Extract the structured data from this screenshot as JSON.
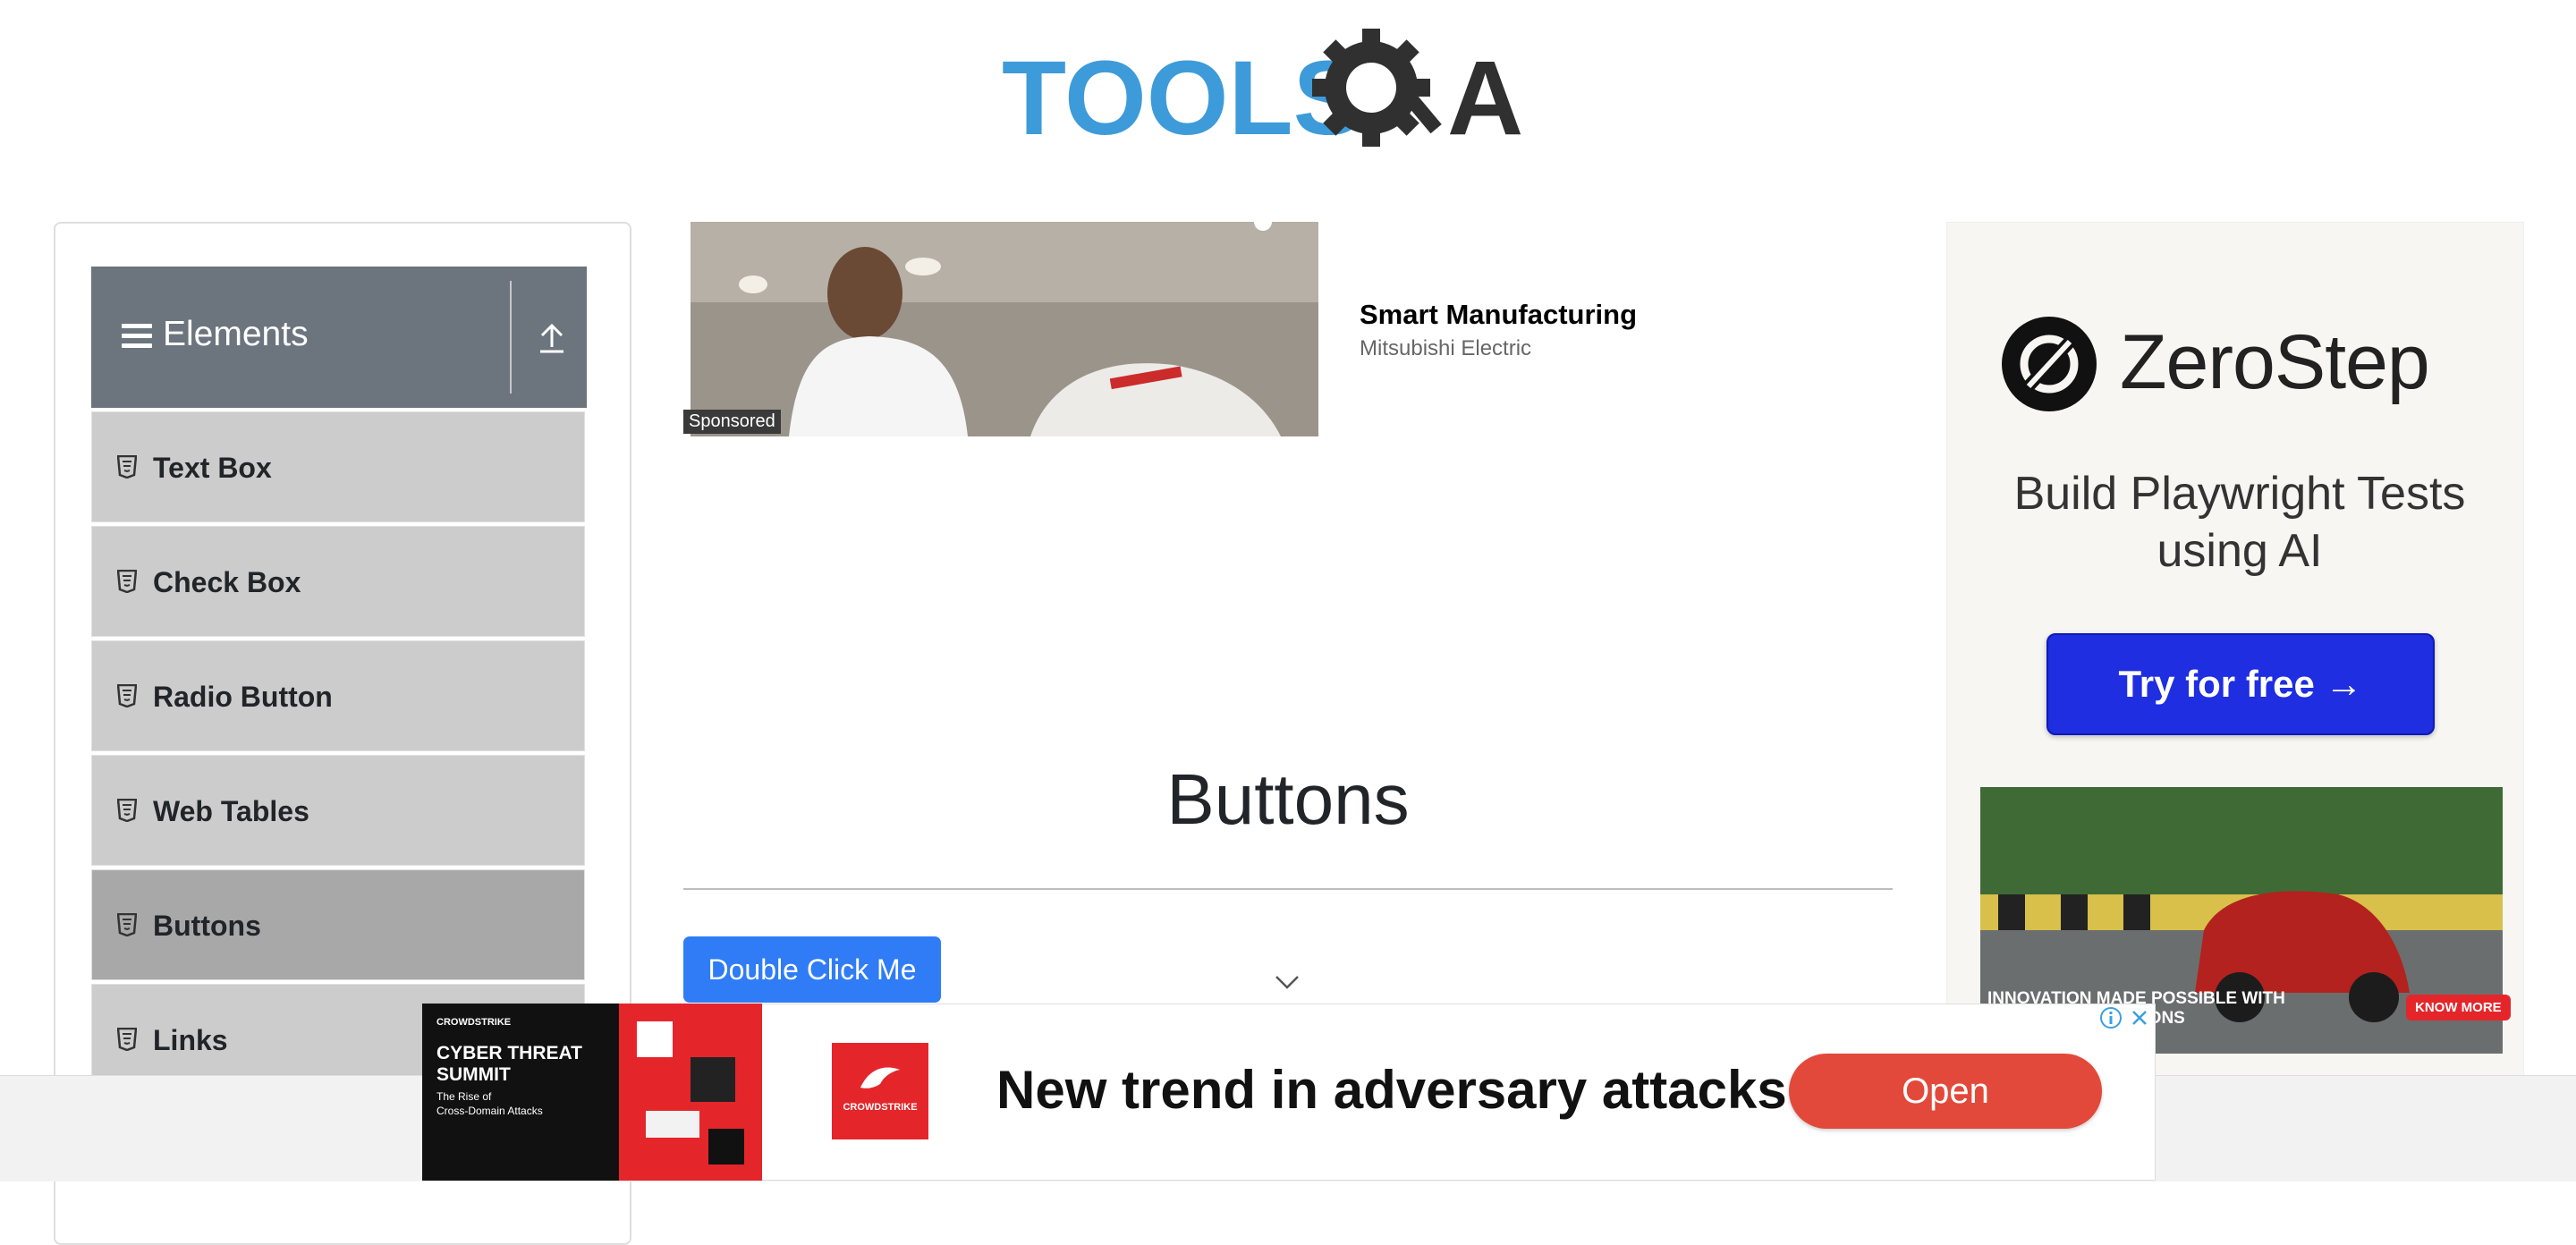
{
  "header": {
    "logo_text_left": "TOOLS",
    "logo_text_right": "A"
  },
  "sidebar": {
    "group_title": "Elements",
    "items": [
      {
        "label": "Text Box",
        "active": false
      },
      {
        "label": "Check Box",
        "active": false
      },
      {
        "label": "Radio Button",
        "active": false
      },
      {
        "label": "Web Tables",
        "active": false
      },
      {
        "label": "Buttons",
        "active": true
      },
      {
        "label": "Links",
        "active": false
      }
    ]
  },
  "center_ad": {
    "sponsored_label": "Sponsored",
    "title": "Smart Manufacturing",
    "advertiser": "Mitsubishi Electric"
  },
  "main": {
    "page_title": "Buttons",
    "double_click_button": "Double Click Me"
  },
  "right_ad": {
    "brand": "ZeroStep",
    "tagline": "Build Playwright Tests using AI",
    "cta": "Try for free →",
    "car_caption_line1": "INNOVATION MADE POSSIBLE WITH",
    "car_caption_line2": "SOLUTIONS",
    "car_cta": "KNOW MORE"
  },
  "bottom_ad": {
    "poster_brand": "CROWDSTRIKE",
    "poster_title": "CYBER THREAT SUMMIT",
    "poster_subtitle": "The Rise of Cross-Domain Attacks",
    "logo_text": "CROWDSTRIKE",
    "headline": "New trend in adversary attacks",
    "cta": "Open"
  },
  "colors": {
    "sidebar_header": "#6c757d",
    "menu_item": "#cccccc",
    "menu_item_active": "#a8a8a8",
    "primary_button": "#2f7cf6",
    "zerostep_cta": "#1e2ee0",
    "open_button": "#e3493a",
    "logo_blue": "#3d9bd9"
  }
}
